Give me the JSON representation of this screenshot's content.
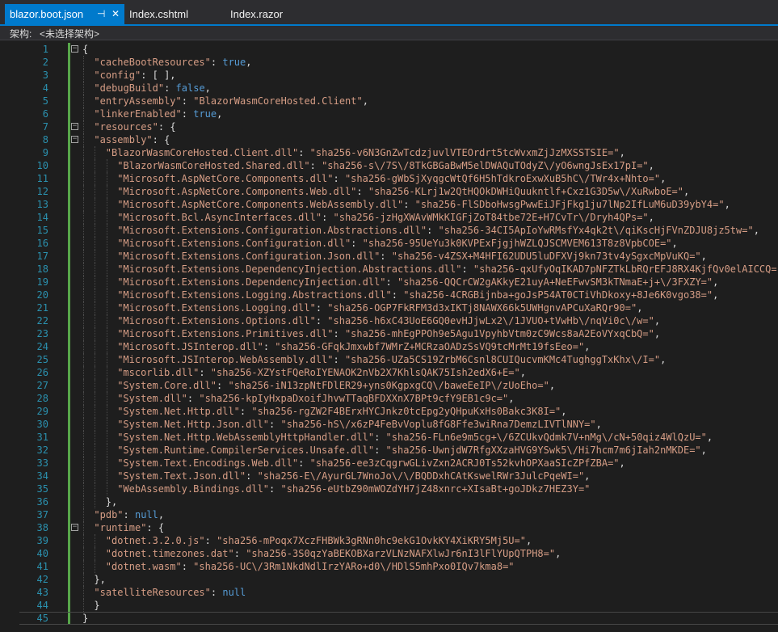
{
  "tabs": [
    {
      "label": "blazor.boot.json",
      "active": true,
      "pin": "⊣",
      "close": "✕"
    },
    {
      "label": "Index.cshtml",
      "active": false
    },
    {
      "label": "Index.razor",
      "active": false
    }
  ],
  "navbar": {
    "label": "架构:",
    "scope": "<未选择架构>"
  },
  "colors": {
    "accent": "#007acc",
    "string": "#d69d85",
    "keyword": "#569cd6",
    "linenumber": "#2b91af",
    "background": "#1e1e1e"
  },
  "lines": [
    {
      "n": "1",
      "text": "{"
    },
    {
      "n": "2",
      "text": "\"cacheBootResources\": true,"
    },
    {
      "n": "3",
      "text": "\"config\": [ ],"
    },
    {
      "n": "4",
      "text": "\"debugBuild\": false,"
    },
    {
      "n": "5",
      "text": "\"entryAssembly\": \"BlazorWasmCoreHosted.Client\","
    },
    {
      "n": "6",
      "text": "\"linkerEnabled\": true,"
    },
    {
      "n": "7",
      "text": "\"resources\": {"
    },
    {
      "n": "8",
      "text": "\"assembly\": {"
    },
    {
      "n": "9",
      "text": "\"BlazorWasmCoreHosted.Client.dll\": \"sha256-v6N3GnZwTcdzjuvlVTEOrdrt5tcWvxmZjJzMXSSTSIE=\","
    },
    {
      "n": "10",
      "text": "\"BlazorWasmCoreHosted.Shared.dll\": \"sha256-s\\/7S\\/8TkGBGaBwM5elDWAQuTOdyZ\\/yO6wngJsEx17pI=\","
    },
    {
      "n": "11",
      "text": "\"Microsoft.AspNetCore.Components.dll\": \"sha256-gWbSjXyqgcWtQf6H5hTdkroExwXuB5hC\\/TWr4x+Nhto=\","
    },
    {
      "n": "12",
      "text": "\"Microsoft.AspNetCore.Components.Web.dll\": \"sha256-KLrj1w2QtHQOkDWHiQuukntlf+Cxz1G3D5w\\/XuRwboE=\","
    },
    {
      "n": "13",
      "text": "\"Microsoft.AspNetCore.Components.WebAssembly.dll\": \"sha256-FlSDboHwsgPwwEiJFjFkg1ju7lNp2IfLuM6uD39ybY4=\","
    },
    {
      "n": "14",
      "text": "\"Microsoft.Bcl.AsyncInterfaces.dll\": \"sha256-jzHgXWAvWMkKIGFjZoT84tbe72E+H7CvTr\\/Dryh4QPs=\","
    },
    {
      "n": "15",
      "text": "\"Microsoft.Extensions.Configuration.Abstractions.dll\": \"sha256-34CI5ApIoYwRMsfYx4qk2t\\/qiKscHjFVnZDJU8jz5tw=\","
    },
    {
      "n": "16",
      "text": "\"Microsoft.Extensions.Configuration.dll\": \"sha256-95UeYu3k0KVPExFjgjhWZLQJSCMVEM613T8z8VpbCOE=\","
    },
    {
      "n": "17",
      "text": "\"Microsoft.Extensions.Configuration.Json.dll\": \"sha256-v4ZSX+M4HFI62UDU5luDFXVj9kn73tv4ySgxcMpVuKQ=\","
    },
    {
      "n": "18",
      "text": "\"Microsoft.Extensions.DependencyInjection.Abstractions.dll\": \"sha256-qxUfyOqIKAD7pNFZTkLbRQrEFJ8RX4KjfQv0elAICCQ=\","
    },
    {
      "n": "19",
      "text": "\"Microsoft.Extensions.DependencyInjection.dll\": \"sha256-QQCrCW2gAKkyE21uyA+NeEFwvSM3kTNmaE+j+\\/3FXZY=\","
    },
    {
      "n": "20",
      "text": "\"Microsoft.Extensions.Logging.Abstractions.dll\": \"sha256-4CRGBijnba+goJsP54AT0CTiVhDkoxy+8Je6K0vgo38=\","
    },
    {
      "n": "21",
      "text": "\"Microsoft.Extensions.Logging.dll\": \"sha256-OGP7FkRFM3d3xIKTj8NAWX66k5UWHgnvAPCuXaRQr90=\","
    },
    {
      "n": "22",
      "text": "\"Microsoft.Extensions.Options.dll\": \"sha256-h6xC43UoE6GQ0evHJjwLx2\\/1JVUO+tVwHb\\/nqVi0c\\/w=\","
    },
    {
      "n": "23",
      "text": "\"Microsoft.Extensions.Primitives.dll\": \"sha256-mhEgPPOh9e5Agu1VpyhbVtm0zC9Wcs8aA2EoVYxqCbQ=\","
    },
    {
      "n": "24",
      "text": "\"Microsoft.JSInterop.dll\": \"sha256-GFqkJmxwbf7WMrZ+MCRzaOADzSsVQ9tcMrMt19fsEeo=\","
    },
    {
      "n": "25",
      "text": "\"Microsoft.JSInterop.WebAssembly.dll\": \"sha256-UZa5CS19ZrbM6Csnl8CUIQucvmKMc4TughggTxKhx\\/I=\","
    },
    {
      "n": "26",
      "text": "\"mscorlib.dll\": \"sha256-XZYstFQeRoIYENAOK2nVb2X7KhlsQAK75Ish2edX6+E=\","
    },
    {
      "n": "27",
      "text": "\"System.Core.dll\": \"sha256-iN13zpNtFDlER29+yns0KgpxgCQ\\/baweEeIP\\/zUoEho=\","
    },
    {
      "n": "28",
      "text": "\"System.dll\": \"sha256-kpIyHxpaDxoifJhvwTTaqBFDXXnX7BPt9cfY9EB1c9c=\","
    },
    {
      "n": "29",
      "text": "\"System.Net.Http.dll\": \"sha256-rgZW2F4BErxHYCJnkz0tcEpg2yQHpuKxHs0Bakc3K8I=\","
    },
    {
      "n": "30",
      "text": "\"System.Net.Http.Json.dll\": \"sha256-hS\\/x6zP4FeBvVoplu8fG8Ffe3wiRna7DemzLIVTlNNY=\","
    },
    {
      "n": "31",
      "text": "\"System.Net.Http.WebAssemblyHttpHandler.dll\": \"sha256-FLn6e9m5cg+\\/6ZCUkvQdmk7V+nMg\\/cN+50qiz4WlQzU=\","
    },
    {
      "n": "32",
      "text": "\"System.Runtime.CompilerServices.Unsafe.dll\": \"sha256-UwnjdW7RfgXXzaHVG9YSwk5\\/Hi7hcm7m6jIah2nMKDE=\","
    },
    {
      "n": "33",
      "text": "\"System.Text.Encodings.Web.dll\": \"sha256-ee3zCqgrwGLivZxn2ACRJ0Ts52kvhOPXaaSIcZPfZBA=\","
    },
    {
      "n": "34",
      "text": "\"System.Text.Json.dll\": \"sha256-E\\/AyurGL7WnoJo\\/\\/BQDDxhCAtKswelRWr3JulcPqeWI=\","
    },
    {
      "n": "35",
      "text": "\"WebAssembly.Bindings.dll\": \"sha256-eUtbZ90mWOZdYH7jZ48xnrc+XIsaBt+goJDkz7HEZ3Y=\""
    },
    {
      "n": "36",
      "text": "},"
    },
    {
      "n": "37",
      "text": "\"pdb\": null,"
    },
    {
      "n": "38",
      "text": "\"runtime\": {"
    },
    {
      "n": "39",
      "text": "\"dotnet.3.2.0.js\": \"sha256-mPoqx7XczFHBWk3gRNn0hc9ekG1OvkKY4XiKRY5Mj5U=\","
    },
    {
      "n": "40",
      "text": "\"dotnet.timezones.dat\": \"sha256-3S0qzYaBEKOBXarzVLNzNAFXlwJr6nI3lFlYUpQTPH8=\","
    },
    {
      "n": "41",
      "text": "\"dotnet.wasm\": \"sha256-UC\\/3Rm1NkdNdlIrzYARo+d0\\/HDlS5mhPxo0IQv7kma8=\""
    },
    {
      "n": "42",
      "text": "},"
    },
    {
      "n": "43",
      "text": "\"satelliteResources\": null"
    },
    {
      "n": "44",
      "text": "}"
    },
    {
      "n": "45",
      "text": "}"
    }
  ]
}
